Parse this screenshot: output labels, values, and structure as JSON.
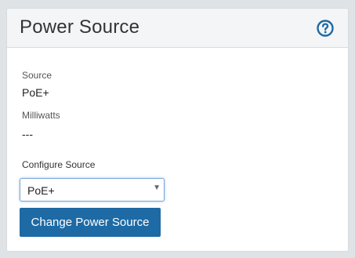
{
  "panel": {
    "title": "Power Source",
    "help_icon": "help-circle-icon"
  },
  "fields": {
    "source_label": "Source",
    "source_value": "PoE+",
    "milliwatts_label": "Milliwatts",
    "milliwatts_value": "---"
  },
  "configure": {
    "label": "Configure Source",
    "selected": "PoE+",
    "caret_icon": "caret-down-icon",
    "button_label": "Change Power Source"
  },
  "colors": {
    "accent": "#1d6aa5",
    "header_bg": "#f4f5f6",
    "page_bg": "#dfe3e6"
  }
}
